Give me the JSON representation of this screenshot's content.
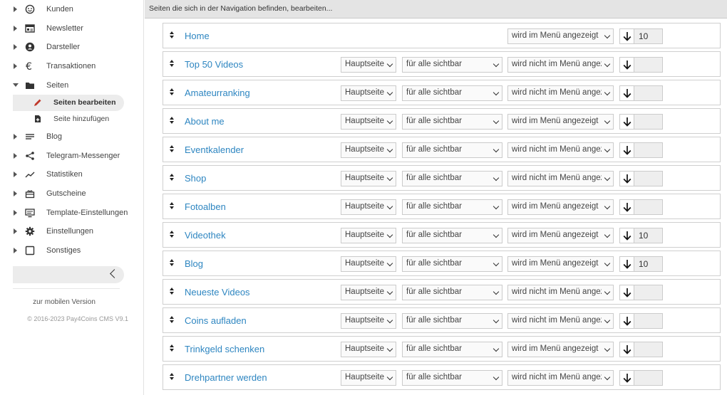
{
  "sidebar": {
    "items": [
      {
        "label": "Kunden",
        "icon": "smiley-icon"
      },
      {
        "label": "Newsletter",
        "icon": "newsletter-icon"
      },
      {
        "label": "Darsteller",
        "icon": "person-icon"
      },
      {
        "label": "Transaktionen",
        "icon": "euro-icon"
      },
      {
        "label": "Seiten",
        "icon": "folder-icon"
      },
      {
        "label": "Blog",
        "icon": "lines-icon"
      },
      {
        "label": "Telegram-Messenger",
        "icon": "share-icon"
      },
      {
        "label": "Statistiken",
        "icon": "chart-icon"
      },
      {
        "label": "Gutscheine",
        "icon": "gift-icon"
      },
      {
        "label": "Template-Einstellungen",
        "icon": "monitor-icon"
      },
      {
        "label": "Einstellungen",
        "icon": "gear-icon"
      },
      {
        "label": "Sonstiges",
        "icon": "square-icon"
      }
    ],
    "sub_items": [
      {
        "label": "Seiten bearbeiten",
        "icon": "pencil-icon"
      },
      {
        "label": "Seite hinzufügen",
        "icon": "add-page-icon"
      }
    ],
    "mobile_link": "zur mobilen Version",
    "copyright": "© 2016-2023 Pay4Coins CMS V9.1"
  },
  "header": {
    "title": "Seiten die sich in der Navigation befinden, bearbeiten..."
  },
  "rows": [
    {
      "title": "Home",
      "page_type": "",
      "visibility": "",
      "menu": "wird im Menü angezeigt",
      "order": "10"
    },
    {
      "title": "Top 50 Videos",
      "page_type": "Hauptseite",
      "visibility": "für alle sichtbar",
      "menu": "wird nicht im Menü angezeigt",
      "order": ""
    },
    {
      "title": "Amateurranking",
      "page_type": "Hauptseite",
      "visibility": "für alle sichtbar",
      "menu": "wird nicht im Menü angezeigt",
      "order": ""
    },
    {
      "title": "About me",
      "page_type": "Hauptseite",
      "visibility": "für alle sichtbar",
      "menu": "wird im Menü angezeigt",
      "order": ""
    },
    {
      "title": "Eventkalender",
      "page_type": "Hauptseite",
      "visibility": "für alle sichtbar",
      "menu": "wird nicht im Menü angezeigt",
      "order": ""
    },
    {
      "title": "Shop",
      "page_type": "Hauptseite",
      "visibility": "für alle sichtbar",
      "menu": "wird nicht im Menü angezeigt",
      "order": ""
    },
    {
      "title": "Fotoalben",
      "page_type": "Hauptseite",
      "visibility": "für alle sichtbar",
      "menu": "wird im Menü angezeigt",
      "order": ""
    },
    {
      "title": "Videothek",
      "page_type": "Hauptseite",
      "visibility": "für alle sichtbar",
      "menu": "wird im Menü angezeigt",
      "order": "10"
    },
    {
      "title": "Blog",
      "page_type": "Hauptseite",
      "visibility": "für alle sichtbar",
      "menu": "wird im Menü angezeigt",
      "order": "10"
    },
    {
      "title": "Neueste Videos",
      "page_type": "Hauptseite",
      "visibility": "für alle sichtbar",
      "menu": "wird nicht im Menü angezeigt",
      "order": ""
    },
    {
      "title": "Coins aufladen",
      "page_type": "Hauptseite",
      "visibility": "für alle sichtbar",
      "menu": "wird nicht im Menü angezeigt",
      "order": ""
    },
    {
      "title": "Trinkgeld schenken",
      "page_type": "Hauptseite",
      "visibility": "für alle sichtbar",
      "menu": "wird im Menü angezeigt",
      "order": ""
    },
    {
      "title": "Drehpartner werden",
      "page_type": "Hauptseite",
      "visibility": "für alle sichtbar",
      "menu": "wird nicht im Menü angezeigt",
      "order": ""
    }
  ]
}
